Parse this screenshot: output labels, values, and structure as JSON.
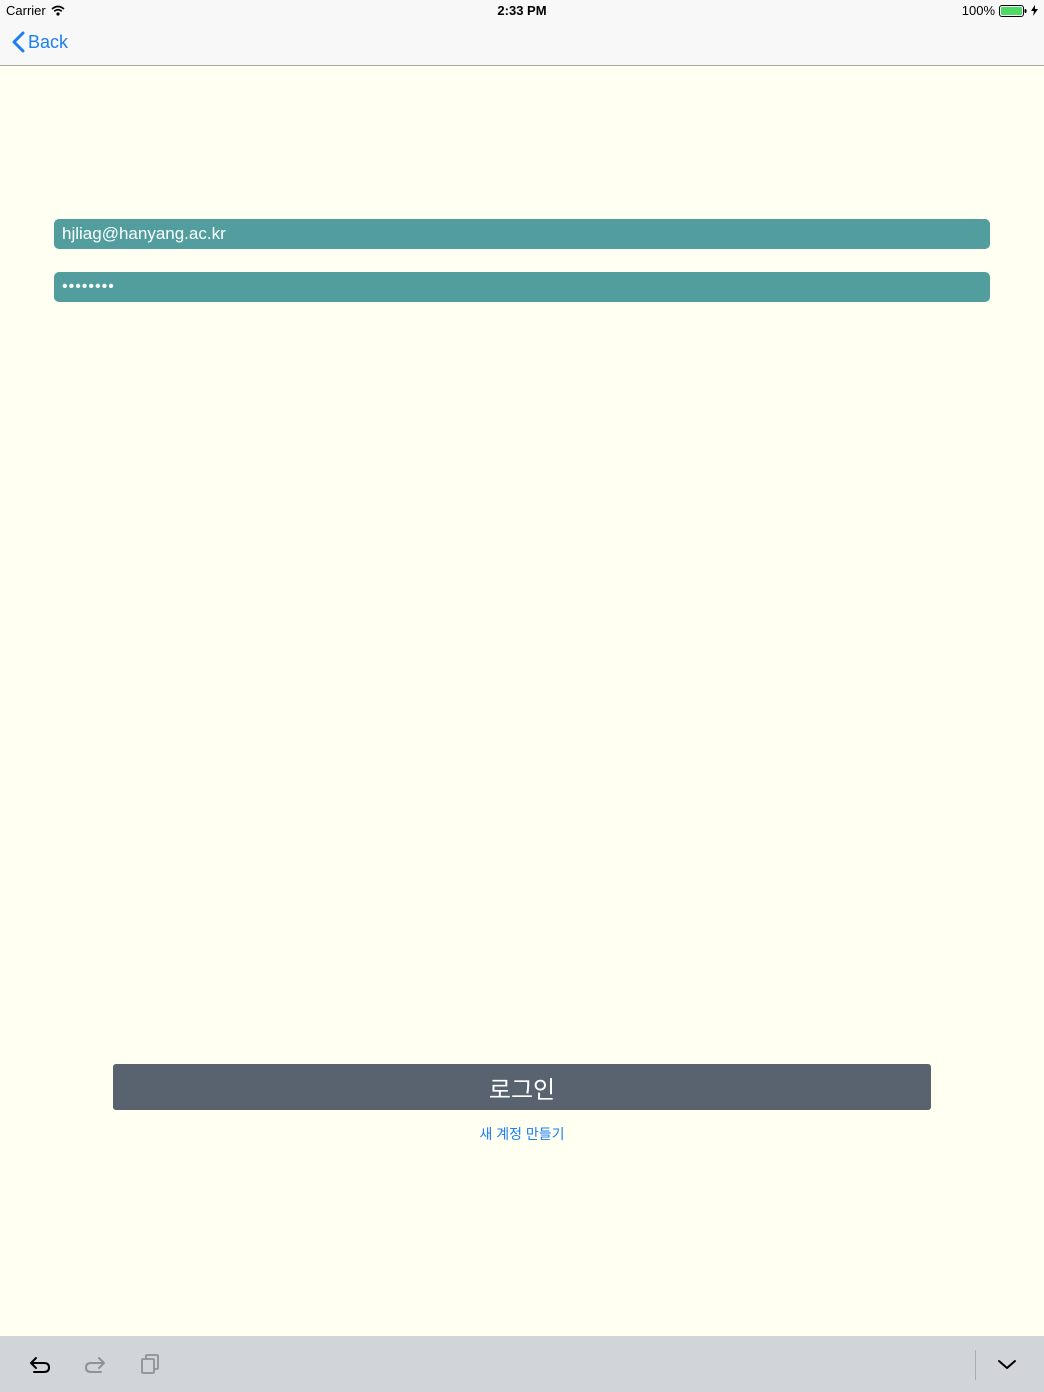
{
  "status_bar": {
    "carrier": "Carrier",
    "time": "2:33 PM",
    "battery": "100%"
  },
  "nav": {
    "back_label": "Back"
  },
  "form": {
    "email_value": "hjliag@hanyang.ac.kr",
    "password_value": "••••••••"
  },
  "actions": {
    "login_label": "로그인",
    "signup_label": "새 계정 만들기"
  },
  "toolbar": {
    "icons": [
      "undo-icon",
      "redo-icon",
      "paste-icon",
      "keyboard-dismiss-icon"
    ]
  },
  "colors": {
    "background": "#fffff2",
    "field": "#529e9e",
    "login_button": "#58636f",
    "link": "#1a7ef5",
    "battery": "#4cd964"
  }
}
